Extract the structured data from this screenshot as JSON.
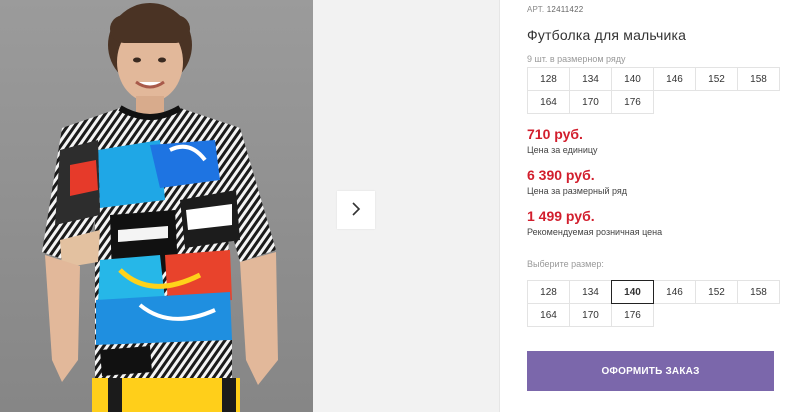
{
  "product": {
    "sku_label": "АРТ.",
    "sku": "12411422",
    "title": "Футболка для мальчика"
  },
  "size_row": {
    "label": "9 шт. в размерном ряду",
    "sizes": [
      "128",
      "134",
      "140",
      "146",
      "152",
      "158",
      "164",
      "170",
      "176"
    ]
  },
  "prices": {
    "unit_price": "710 руб.",
    "unit_note": "Цена за единицу",
    "row_price": "6 390 руб.",
    "row_note": "Цена за размерный ряд",
    "retail_price": "1 499 руб.",
    "retail_note": "Рекомендуемая розничная цена",
    "price_color": "#d21e2d"
  },
  "size_select": {
    "label": "Выберите размер:",
    "sizes": [
      "128",
      "134",
      "140",
      "146",
      "152",
      "158",
      "164",
      "170",
      "176"
    ],
    "selected": "140"
  },
  "actions": {
    "order_label": "ОФОРМИТЬ ЗАКАЗ",
    "order_color": "#7b67ab"
  },
  "gallery": {
    "next_icon": "chevron-right-icon"
  }
}
